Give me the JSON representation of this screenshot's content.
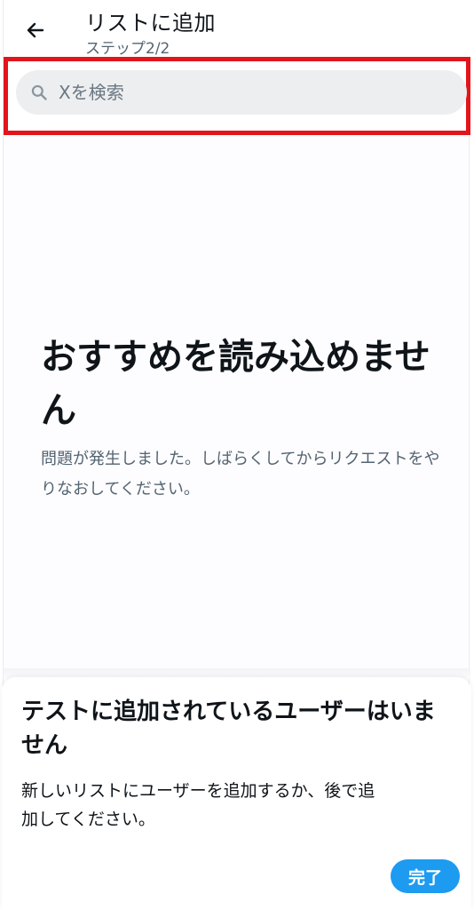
{
  "header": {
    "back_icon": "arrow-left-icon",
    "title": "リストに追加",
    "subtitle": "ステップ2/2"
  },
  "search": {
    "icon": "search-icon",
    "placeholder": "Xを検索",
    "value": ""
  },
  "error": {
    "title": "おすすめを読み込めません",
    "message": "問題が発生しました。しばらくしてからリクエストをやりなおしてください。"
  },
  "sheet": {
    "title": "テストに追加されているユーザーはいません",
    "message": "新しいリストにユーザーを追加するか、後で追加してください。",
    "done_label": "完了"
  },
  "colors": {
    "accent": "#1d9bf0",
    "highlight": "#e3141b",
    "text_primary": "#0f1419",
    "text_secondary": "#536471"
  }
}
